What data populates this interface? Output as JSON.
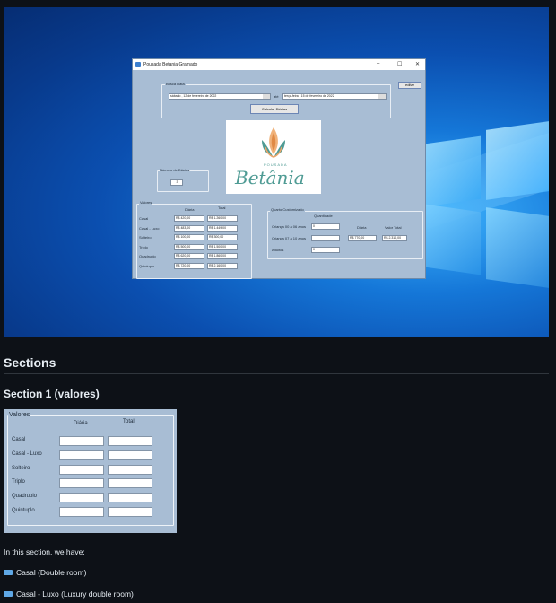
{
  "window": {
    "title": "Pousada Betania Gramado",
    "controls": [
      "–",
      "☐",
      "✕"
    ]
  },
  "busca_data": {
    "group_label": "Busca Data",
    "date_from": "sábado   ,  12 de fevereiro  de 2022",
    "separator": "até",
    "date_to": "terça-feira  ,  15 de fevereiro  de 2022",
    "calc_button": "Calcular Diárias",
    "edit_button": "editar"
  },
  "logo": {
    "small_text": "POUSADA",
    "name": "Betânia"
  },
  "numero_diarias": {
    "label": "Número de Diárias",
    "value": "3"
  },
  "valores": {
    "group_label": "Valores",
    "col_diaria": "Diária",
    "col_total": "Total",
    "rows": [
      {
        "label": "Casal",
        "diaria": "R$ 420,00",
        "total": "R$ 1.260,00"
      },
      {
        "label": "Casal - Luxo",
        "diaria": "R$ 483,00",
        "total": "R$ 1.449,00"
      },
      {
        "label": "Solteiro",
        "diaria": "R$ 100,00",
        "total": "R$ 300,00"
      },
      {
        "label": "Triplo",
        "diaria": "R$ 500,00",
        "total": "R$ 1.500,00"
      },
      {
        "label": "Quadruplo",
        "diaria": "R$ 620,00",
        "total": "R$ 1.860,00"
      },
      {
        "label": "Quintuplo",
        "diaria": "R$ 720,00",
        "total": "R$ 2.160,00"
      }
    ]
  },
  "quarto": {
    "group_label": "Quarto Customizado",
    "col_quantidade": "Quantidade",
    "col_diaria": "Diária",
    "col_valor_total": "Valor Total",
    "rows": [
      {
        "label": "Criança 00 a 06 anos",
        "quantidade": "0"
      },
      {
        "label": "Criança 07 a 10 anos",
        "quantidade": ""
      },
      {
        "label": "Adultos",
        "quantidade": "0"
      }
    ],
    "diaria": "R$ 770,00",
    "valor_total": "R$ 2.310,00"
  },
  "article": {
    "heading": "Sections",
    "section1_heading": "Section 1 (valores)",
    "panel": {
      "group_label": "Valores",
      "col_diaria": "Diária",
      "col_total": "Total",
      "rows": [
        "Casal",
        "Casal - Luxo",
        "Solteiro",
        "Triplo",
        "Quadruplo",
        "Quintuplo"
      ]
    },
    "intro": "In this section, we have:",
    "list": [
      "Casal (Double room)",
      "Casal - Luxo (Luxury double room)"
    ]
  },
  "colors": {
    "form_bg": "#a8bdd4",
    "page_bg": "#0d1117",
    "desktop_blue": "#0b4fb0",
    "logo_orange": "#e9a56a",
    "logo_teal": "#4f9b94"
  }
}
